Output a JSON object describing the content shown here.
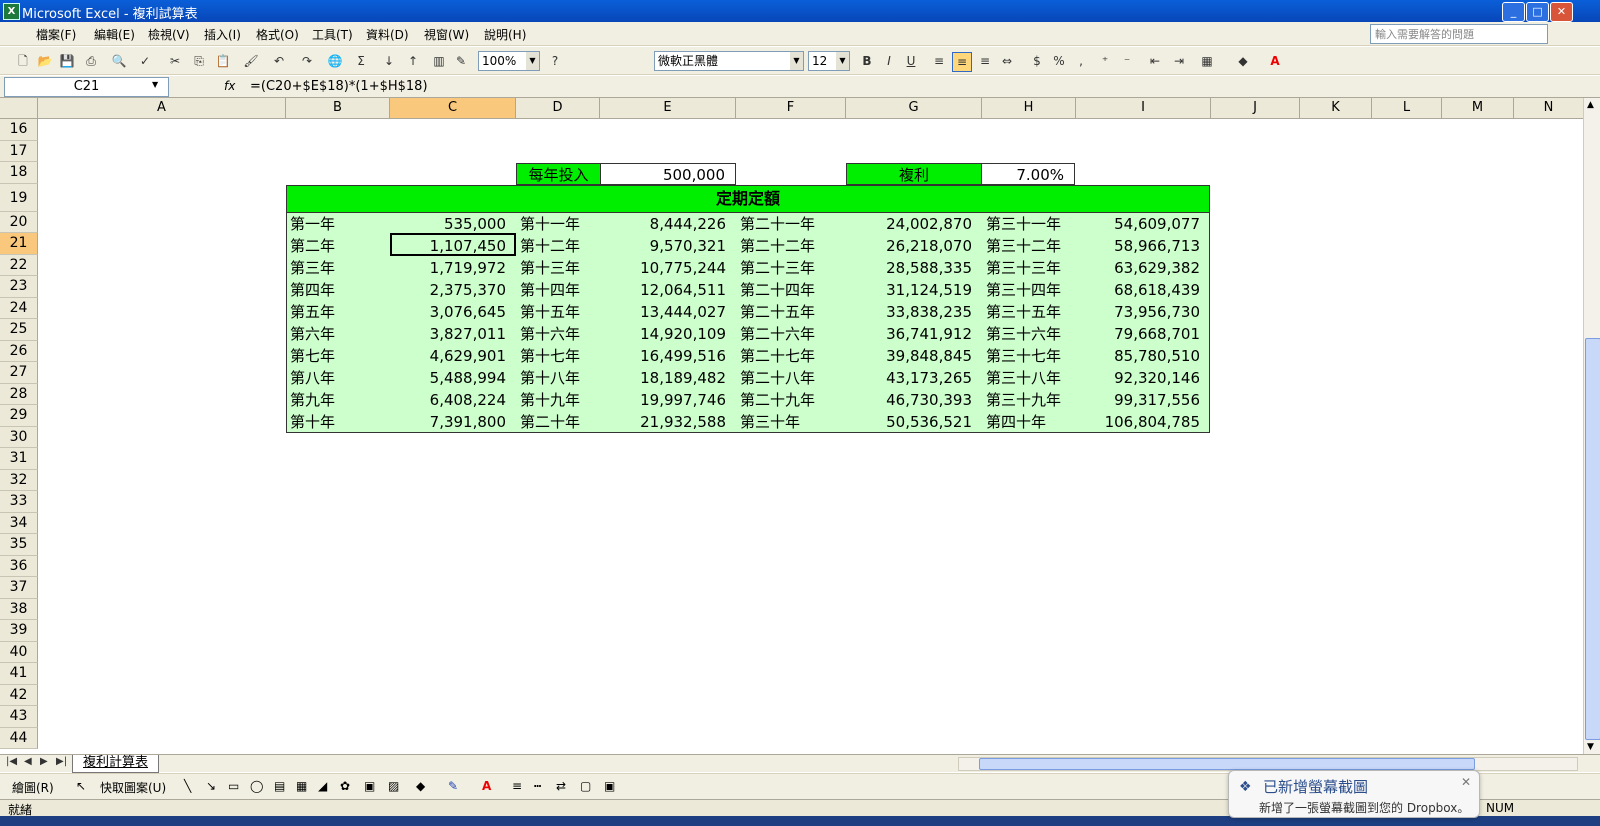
{
  "window": {
    "title": "Microsoft Excel - 複利試算表",
    "min": "_",
    "max": "□",
    "close": "✕"
  },
  "menu": {
    "items": [
      "檔案(F)",
      "編輯(E)",
      "檢視(V)",
      "插入(I)",
      "格式(O)",
      "工具(T)",
      "資料(D)",
      "視窗(W)",
      "說明(H)"
    ],
    "help_placeholder": "輸入需要解答的問題"
  },
  "toolbar": {
    "zoom": "100%",
    "font": "微軟正黑體",
    "size": "12",
    "bold": "B",
    "italic": "I",
    "underline": "U",
    "currency": "$",
    "percent": "%",
    "comma": ","
  },
  "formula_bar": {
    "name_box": "C21",
    "fx": "fx",
    "formula": "=(C20+$E$18)*(1+$H$18)"
  },
  "columns": [
    "A",
    "B",
    "C",
    "D",
    "E",
    "F",
    "G",
    "H",
    "I",
    "J",
    "K",
    "L",
    "M",
    "N"
  ],
  "selected_column": "C",
  "rows": [
    16,
    17,
    18,
    19,
    20,
    21,
    22,
    23,
    24,
    25,
    26,
    27,
    28,
    29,
    30,
    31,
    32,
    33,
    34,
    35,
    36,
    37,
    38,
    39,
    40,
    41,
    42,
    43,
    44
  ],
  "selected_row": 21,
  "inputs": {
    "annual_label": "每年投入",
    "annual_value": "500,000",
    "rate_label": "複利",
    "rate_value": "7.00%"
  },
  "table": {
    "title": "定期定額",
    "rows": [
      [
        [
          "第一年",
          "535,000"
        ],
        [
          "第十一年",
          "8,444,226"
        ],
        [
          "第二十一年",
          "24,002,870"
        ],
        [
          "第三十一年",
          "54,609,077"
        ]
      ],
      [
        [
          "第二年",
          "1,107,450"
        ],
        [
          "第十二年",
          "9,570,321"
        ],
        [
          "第二十二年",
          "26,218,070"
        ],
        [
          "第三十二年",
          "58,966,713"
        ]
      ],
      [
        [
          "第三年",
          "1,719,972"
        ],
        [
          "第十三年",
          "10,775,244"
        ],
        [
          "第二十三年",
          "28,588,335"
        ],
        [
          "第三十三年",
          "63,629,382"
        ]
      ],
      [
        [
          "第四年",
          "2,375,370"
        ],
        [
          "第十四年",
          "12,064,511"
        ],
        [
          "第二十四年",
          "31,124,519"
        ],
        [
          "第三十四年",
          "68,618,439"
        ]
      ],
      [
        [
          "第五年",
          "3,076,645"
        ],
        [
          "第十五年",
          "13,444,027"
        ],
        [
          "第二十五年",
          "33,838,235"
        ],
        [
          "第三十五年",
          "73,956,730"
        ]
      ],
      [
        [
          "第六年",
          "3,827,011"
        ],
        [
          "第十六年",
          "14,920,109"
        ],
        [
          "第二十六年",
          "36,741,912"
        ],
        [
          "第三十六年",
          "79,668,701"
        ]
      ],
      [
        [
          "第七年",
          "4,629,901"
        ],
        [
          "第十七年",
          "16,499,516"
        ],
        [
          "第二十七年",
          "39,848,845"
        ],
        [
          "第三十七年",
          "85,780,510"
        ]
      ],
      [
        [
          "第八年",
          "5,488,994"
        ],
        [
          "第十八年",
          "18,189,482"
        ],
        [
          "第二十八年",
          "43,173,265"
        ],
        [
          "第三十八年",
          "92,320,146"
        ]
      ],
      [
        [
          "第九年",
          "6,408,224"
        ],
        [
          "第十九年",
          "19,997,746"
        ],
        [
          "第二十九年",
          "46,730,393"
        ],
        [
          "第三十九年",
          "99,317,556"
        ]
      ],
      [
        [
          "第十年",
          "7,391,800"
        ],
        [
          "第二十年",
          "21,932,588"
        ],
        [
          "第三十年",
          "50,536,521"
        ],
        [
          "第四十年",
          "106,804,785"
        ]
      ]
    ]
  },
  "sheet_tab": "複利計算表",
  "draw_toolbar": {
    "draw": "繪圖(R)",
    "autoshapes": "快取圖案(U)"
  },
  "status": {
    "ready": "就緒",
    "num": "NUM"
  },
  "notification": {
    "title": "已新增螢幕截圖",
    "body": "新增了一張螢幕截圖到您的 Dropbox。"
  }
}
